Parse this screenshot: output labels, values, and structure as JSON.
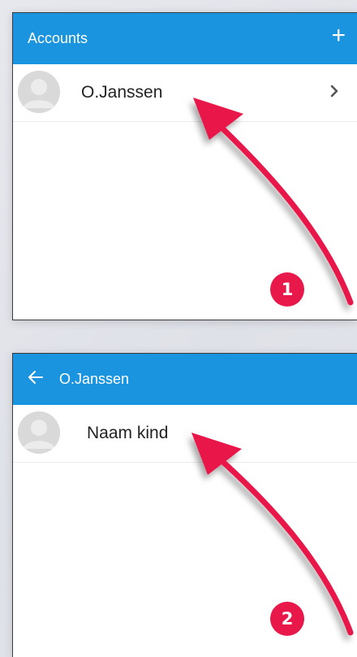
{
  "screen1": {
    "appbar": {
      "title": "Accounts",
      "action_icon": "plus-icon"
    },
    "rows": [
      {
        "label": "O.Janssen",
        "icon": "avatar-placeholder",
        "trailing_icon": "chevron-right-icon"
      }
    ]
  },
  "screen2": {
    "appbar": {
      "title": "O.Janssen",
      "nav_icon": "back-arrow-icon"
    },
    "rows": [
      {
        "label": "Naam kind",
        "icon": "avatar-placeholder"
      }
    ]
  },
  "steps": [
    {
      "number": "1"
    },
    {
      "number": "2"
    }
  ],
  "colors": {
    "appbar": "#1a94de",
    "annotation": "#e8194a",
    "avatar": "#d6d6d6",
    "background": "#e4e5ec"
  }
}
